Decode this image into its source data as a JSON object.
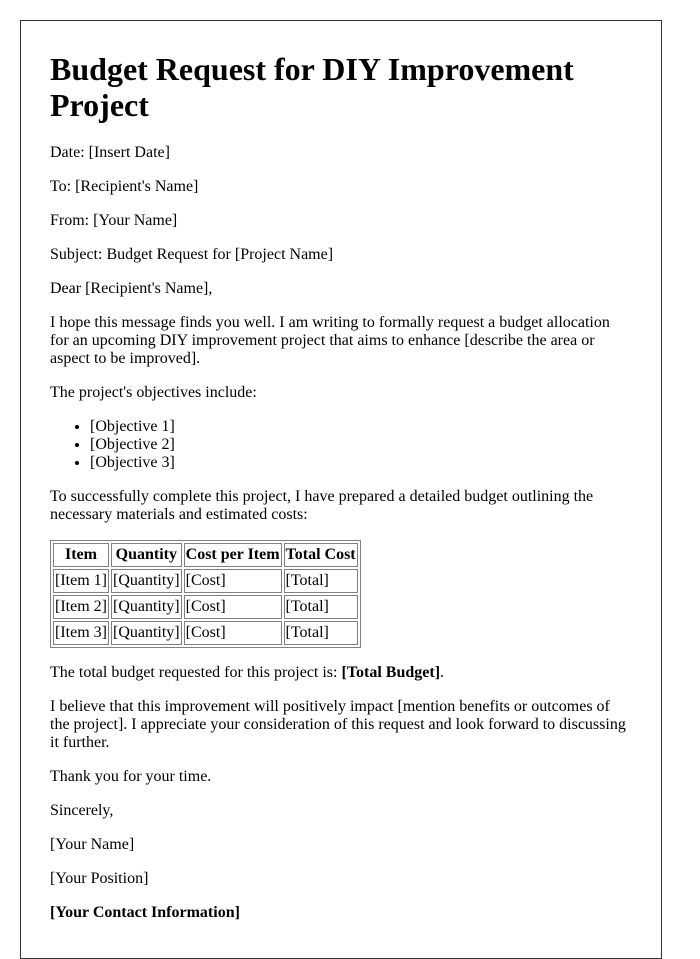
{
  "title": "Budget Request for DIY Improvement Project",
  "header_fields": {
    "date": "Date: [Insert Date]",
    "to": "To: [Recipient's Name]",
    "from": "From: [Your Name]",
    "subject": "Subject: Budget Request for [Project Name]"
  },
  "salutation": "Dear [Recipient's Name],",
  "intro": "I hope this message finds you well. I am writing to formally request a budget allocation for an upcoming DIY improvement project that aims to enhance [describe the area or aspect to be improved].",
  "objectives_intro": "The project's objectives include:",
  "objectives": [
    "[Objective 1]",
    "[Objective 2]",
    "[Objective 3]"
  ],
  "budget_intro": "To successfully complete this project, I have prepared a detailed budget outlining the necessary materials and estimated costs:",
  "table": {
    "headers": [
      "Item",
      "Quantity",
      "Cost per Item",
      "Total Cost"
    ],
    "rows": [
      [
        "[Item 1]",
        "[Quantity]",
        "[Cost]",
        "[Total]"
      ],
      [
        "[Item 2]",
        "[Quantity]",
        "[Cost]",
        "[Total]"
      ],
      [
        "[Item 3]",
        "[Quantity]",
        "[Cost]",
        "[Total]"
      ]
    ]
  },
  "total": {
    "prefix": "The total budget requested for this project is: ",
    "value": "[Total Budget]",
    "suffix": "."
  },
  "closing_paragraph": "I believe that this improvement will positively impact [mention benefits or outcomes of the project]. I appreciate your consideration of this request and look forward to discussing it further.",
  "thanks": "Thank you for your time.",
  "signoff": "Sincerely,",
  "signature": {
    "name": "[Your Name]",
    "position": "[Your Position]",
    "contact": "[Your Contact Information]"
  }
}
